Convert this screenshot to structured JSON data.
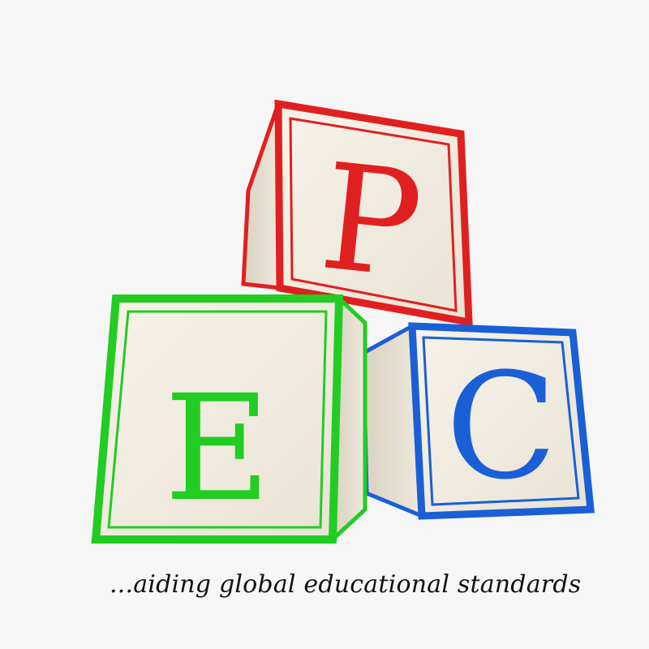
{
  "logo": {
    "blocks": [
      {
        "letter": "P",
        "color": "#e02020",
        "name": "block-p"
      },
      {
        "letter": "E",
        "color": "#22cc22",
        "name": "block-e"
      },
      {
        "letter": "C",
        "color": "#1a5fd6",
        "name": "block-c"
      }
    ],
    "tagline": "...aiding global educational standards",
    "face_color": "#f2ede2",
    "side_color": "#e6e0d2"
  }
}
